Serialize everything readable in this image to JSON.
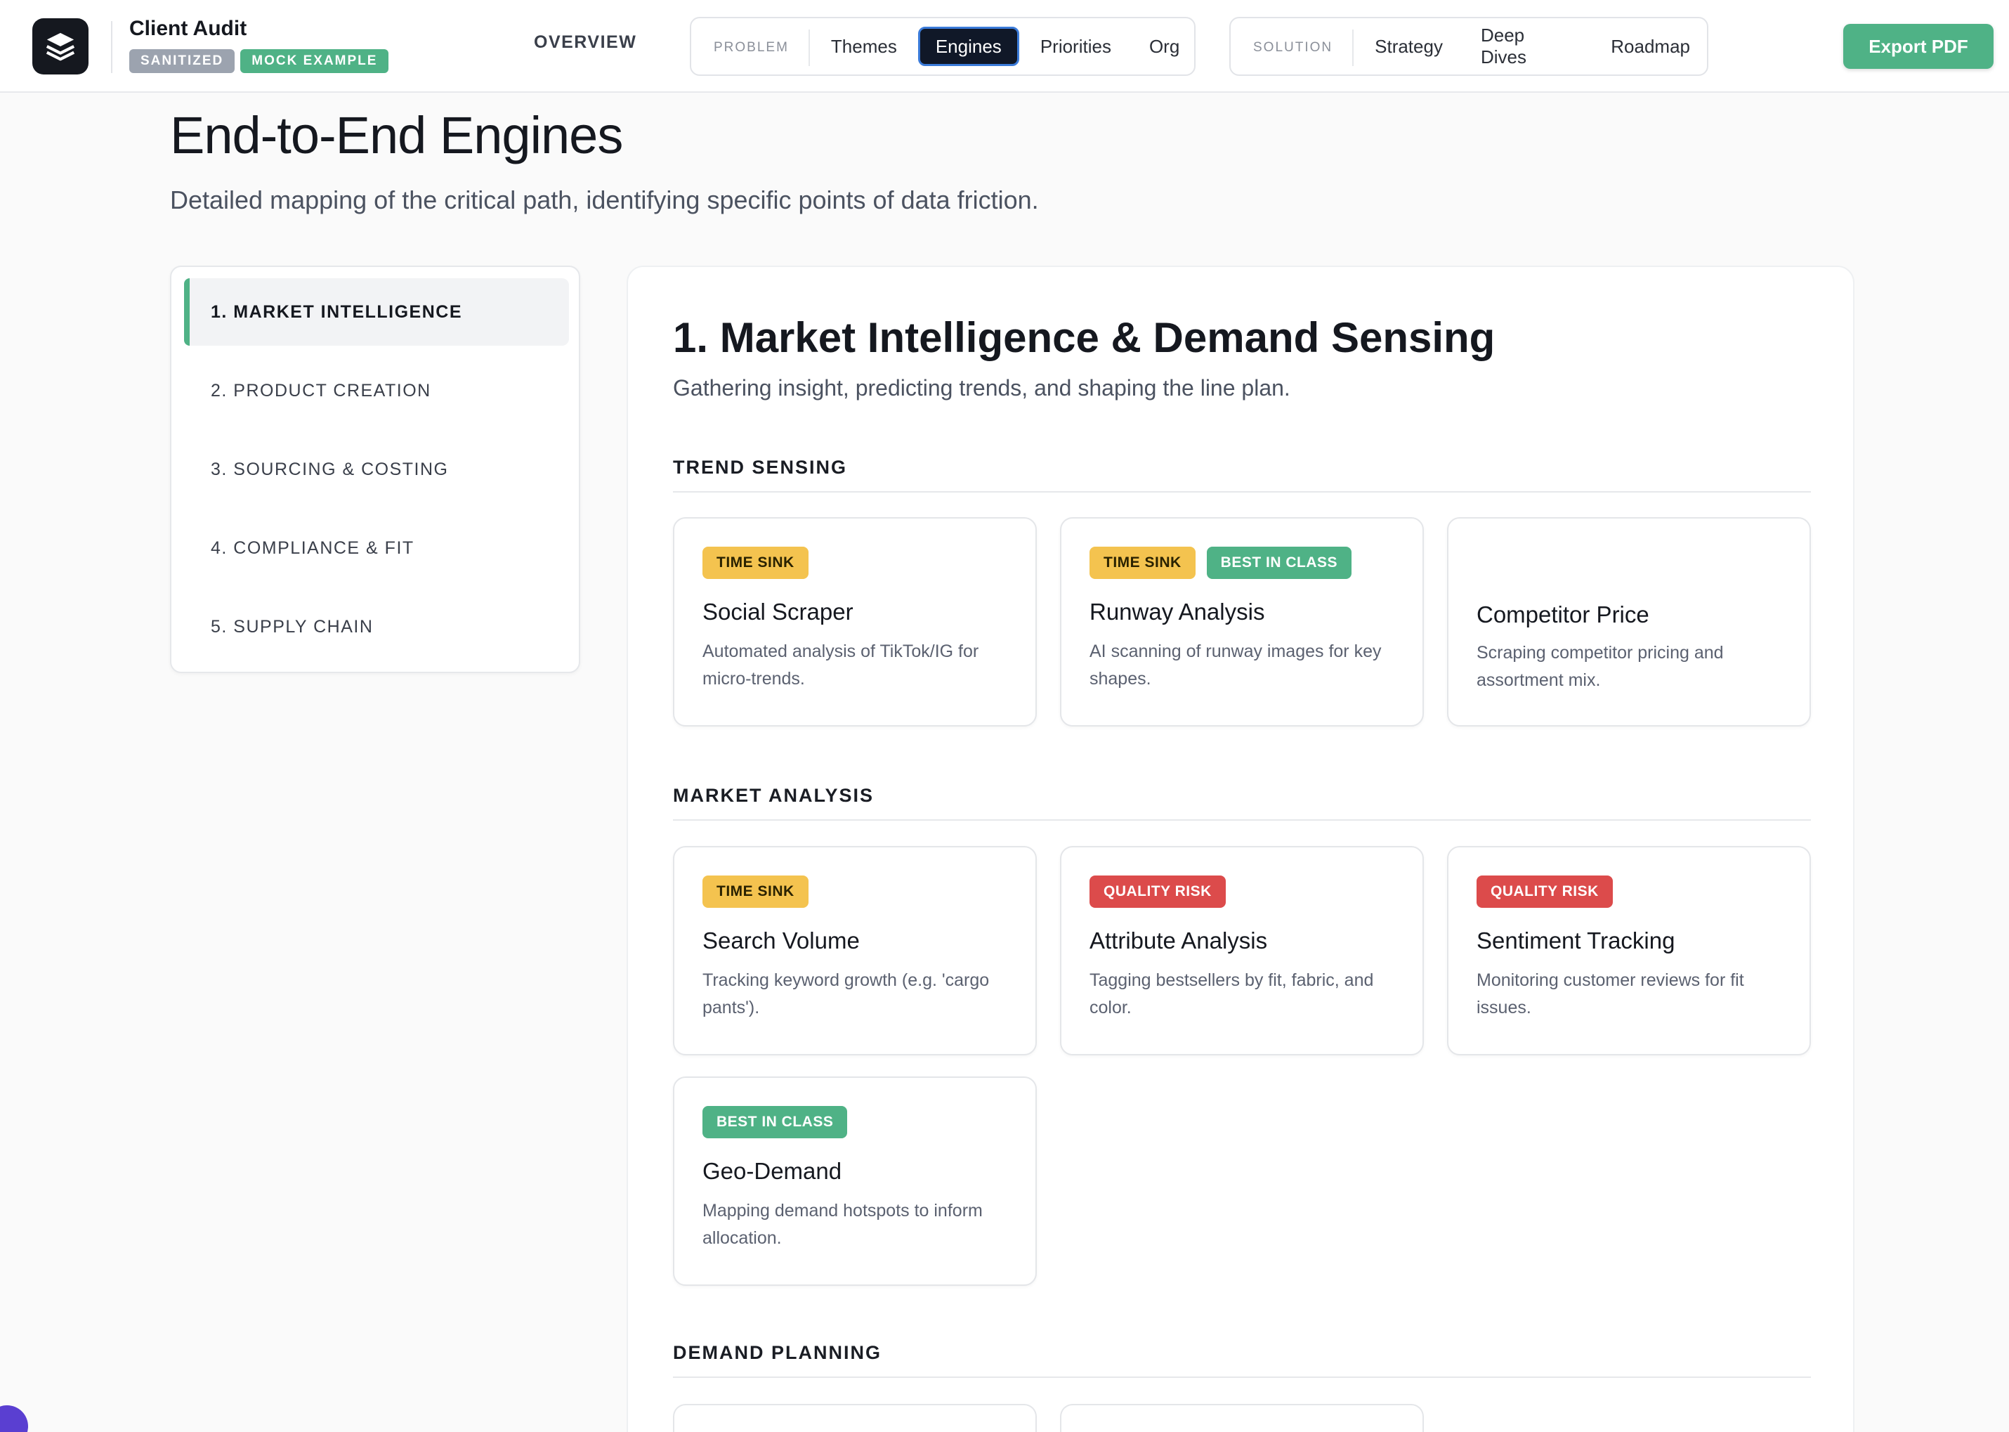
{
  "app": {
    "title": "Client Audit",
    "badges": [
      "SANITIZED",
      "MOCK EXAMPLE"
    ],
    "logo_icon": "layers-icon"
  },
  "nav": {
    "overview": "OVERVIEW",
    "problem": {
      "label": "PROBLEM",
      "tabs": [
        "Themes",
        "Engines",
        "Priorities",
        "Org"
      ],
      "active": "Engines"
    },
    "solution": {
      "label": "SOLUTION",
      "tabs": [
        "Strategy",
        "Deep Dives",
        "Roadmap"
      ]
    },
    "export": "Export PDF"
  },
  "page": {
    "title": "End-to-End Engines",
    "subtitle": "Detailed mapping of the critical path, identifying specific points of data friction."
  },
  "sidebar": {
    "items": [
      {
        "label": "1. MARKET INTELLIGENCE",
        "active": true
      },
      {
        "label": "2. PRODUCT CREATION"
      },
      {
        "label": "3. SOURCING & COSTING"
      },
      {
        "label": "4. COMPLIANCE & FIT"
      },
      {
        "label": "5. SUPPLY CHAIN"
      }
    ]
  },
  "section": {
    "title": "1. Market Intelligence & Demand Sensing",
    "subtitle": "Gathering insight, predicting trends, and shaping the line plan.",
    "groups": [
      {
        "heading": "TREND SENSING",
        "cards": [
          {
            "tags": [
              "TIME SINK"
            ],
            "title": "Social Scraper",
            "desc": "Automated analysis of TikTok/IG for micro-trends."
          },
          {
            "tags": [
              "TIME SINK",
              "BEST IN CLASS"
            ],
            "title": "Runway Analysis",
            "desc": "AI scanning of runway images for key shapes."
          },
          {
            "tags": [],
            "title": "Competitor Price",
            "desc": "Scraping competitor pricing and assortment mix."
          }
        ]
      },
      {
        "heading": "MARKET ANALYSIS",
        "cards": [
          {
            "tags": [
              "TIME SINK"
            ],
            "title": "Search Volume",
            "desc": "Tracking keyword growth (e.g. 'cargo pants')."
          },
          {
            "tags": [
              "QUALITY RISK"
            ],
            "title": "Attribute Analysis",
            "desc": "Tagging bestsellers by fit, fabric, and color."
          },
          {
            "tags": [
              "QUALITY RISK"
            ],
            "title": "Sentiment Tracking",
            "desc": "Monitoring customer reviews for fit issues."
          },
          {
            "tags": [
              "BEST IN CLASS"
            ],
            "title": "Geo-Demand",
            "desc": "Mapping demand hotspots to inform allocation."
          }
        ]
      },
      {
        "heading": "DEMAND PLANNING",
        "cards": []
      }
    ]
  },
  "tag_colors": {
    "TIME SINK": "#f4c34f",
    "BEST IN CLASS": "#4fb286",
    "QUALITY RISK": "#dc4b4b"
  }
}
